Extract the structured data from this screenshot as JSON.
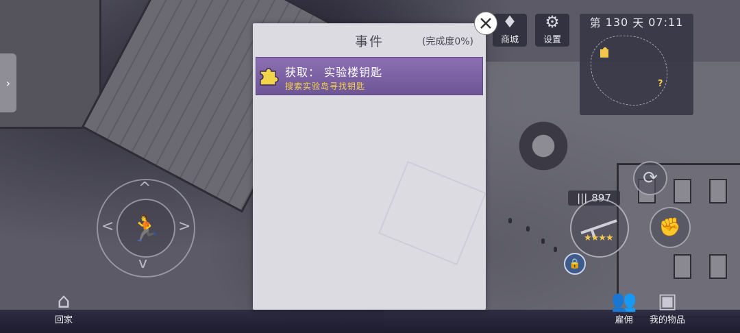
{
  "left_handle": {
    "icon": "chevron-right-icon",
    "glyph": "›"
  },
  "top_bar": {
    "shop": {
      "label": "商城",
      "icon": "diamond-icon",
      "glyph": "♦"
    },
    "settings": {
      "label": "设置",
      "icon": "gear-icon",
      "glyph": "⚙"
    }
  },
  "minimap": {
    "day_prefix": "第",
    "day": "130",
    "day_suffix": "天",
    "time": "07:11"
  },
  "joystick": {
    "icon": "running-man-icon",
    "glyph": "🏃",
    "up": "^",
    "down": "v",
    "left": "<",
    "right": ">"
  },
  "weapon": {
    "ammo_icon": "bullets-icon",
    "ammo_glyph": "|||",
    "ammo": "897",
    "stars": "★★★★",
    "star_count": 4
  },
  "actions": {
    "reload_icon": "reload-icon",
    "reload_glyph": "⟳",
    "melee_icon": "melee-icon",
    "melee_glyph": "✊",
    "lock_icon": "lock-icon",
    "lock_glyph": "🔒"
  },
  "bottom": {
    "home": {
      "label": "回家",
      "icon": "house-icon",
      "glyph": "⌂"
    },
    "team": {
      "label": "雇佣",
      "icon": "group-icon",
      "glyph": "👥"
    },
    "items": {
      "label": "我的物品",
      "icon": "chest-icon",
      "glyph": "▣"
    }
  },
  "dialog": {
    "title": "事件",
    "progress": "(完成度0%)",
    "events": [
      {
        "icon": "puzzle-icon",
        "title": "获取： 实验楼钥匙",
        "desc": "搜索实验岛寻找钥匙"
      }
    ],
    "close_icon": "close-icon"
  },
  "colors": {
    "event_bg": "#7a61a4",
    "event_desc": "#f3d34a",
    "accent_star": "#f2c94c"
  }
}
